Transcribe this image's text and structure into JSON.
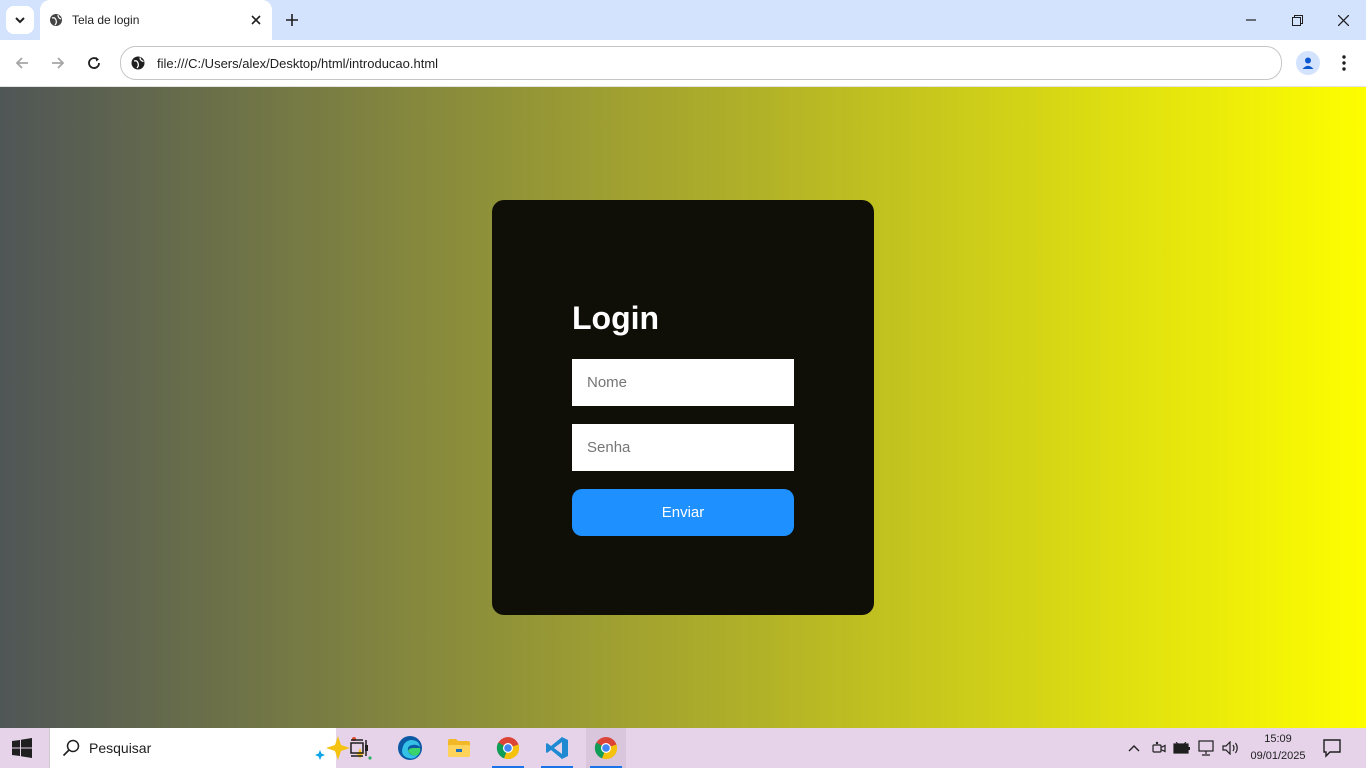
{
  "browser": {
    "tab_title": "Tela de login",
    "url": "file:///C:/Users/alex/Desktop/html/introducao.html"
  },
  "login": {
    "heading": "Login",
    "name_placeholder": "Nome",
    "password_placeholder": "Senha",
    "submit_label": "Enviar"
  },
  "taskbar": {
    "search_label": "Pesquisar",
    "time": "15:09",
    "date": "09/01/2025"
  },
  "colors": {
    "gradient_start": "#4f5656",
    "gradient_end": "#fefe00",
    "card_bg": "#0f0f07",
    "button_bg": "#1e90ff",
    "tabstrip_bg": "#d3e3fd",
    "taskbar_bg": "#e6d3ea"
  }
}
